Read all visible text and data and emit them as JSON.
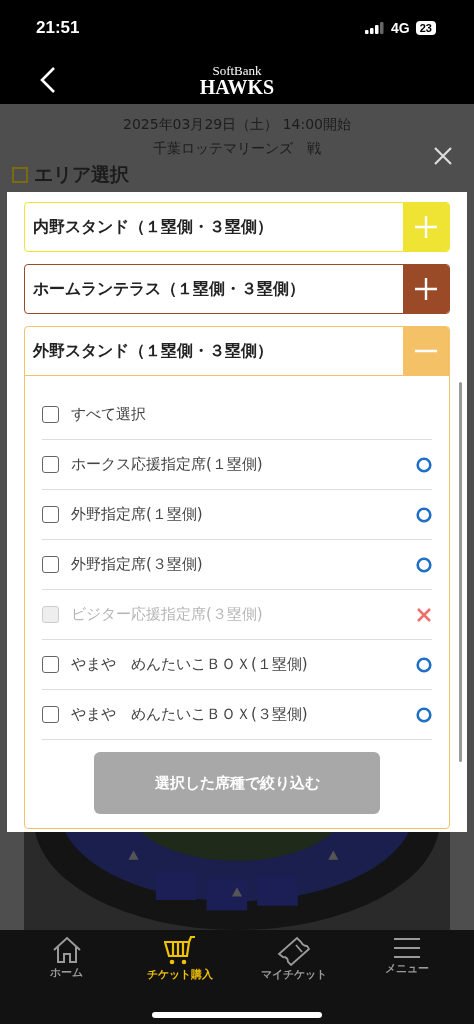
{
  "status_bar": {
    "time": "21:51",
    "network": "4G",
    "battery": "23"
  },
  "header": {
    "logo_top": "SoftBank",
    "logo_main": "HAWKS"
  },
  "event": {
    "date": "2025年03月29日（土） 14:00開始",
    "opponent": "千葉ロッテマリーンズ　戦"
  },
  "section_title": "エリア選択",
  "areas": [
    {
      "label": "内野スタンド（１塁側・３塁側）",
      "color": "#efe334",
      "expanded": false
    },
    {
      "label": "ホームランテラス（１塁側・３塁側）",
      "color": "#9b4a28",
      "expanded": false
    },
    {
      "label": "外野スタンド（１塁側・３塁側）",
      "color": "#f5c166",
      "expanded": true,
      "seats": [
        {
          "kind": "all",
          "label": "すべて選択",
          "checked": false,
          "disabled": false
        },
        {
          "kind": "seat",
          "label": "ホークス応援指定席(１塁側)",
          "checked": false,
          "disabled": false,
          "available": true
        },
        {
          "kind": "seat",
          "label": "外野指定席(１塁側)",
          "checked": false,
          "disabled": false,
          "available": true
        },
        {
          "kind": "seat",
          "label": "外野指定席(３塁側)",
          "checked": false,
          "disabled": false,
          "available": true
        },
        {
          "kind": "seat",
          "label": "ビジター応援指定席(３塁側)",
          "checked": false,
          "disabled": true,
          "available": false
        },
        {
          "kind": "seat",
          "label": "やまや　めんたいこＢＯＸ(１塁側)",
          "checked": false,
          "disabled": false,
          "available": true
        },
        {
          "kind": "seat",
          "label": "やまや　めんたいこＢＯＸ(３塁側)",
          "checked": false,
          "disabled": false,
          "available": true
        }
      ],
      "filter_button": {
        "label": "選択した席種で絞り込む",
        "disabled": true
      }
    }
  ],
  "tabs": [
    {
      "label": "ホーム",
      "selected": false
    },
    {
      "label": "チケット購入",
      "selected": true
    },
    {
      "label": "マイチケット",
      "selected": false
    },
    {
      "label": "メニュー",
      "selected": false
    }
  ]
}
